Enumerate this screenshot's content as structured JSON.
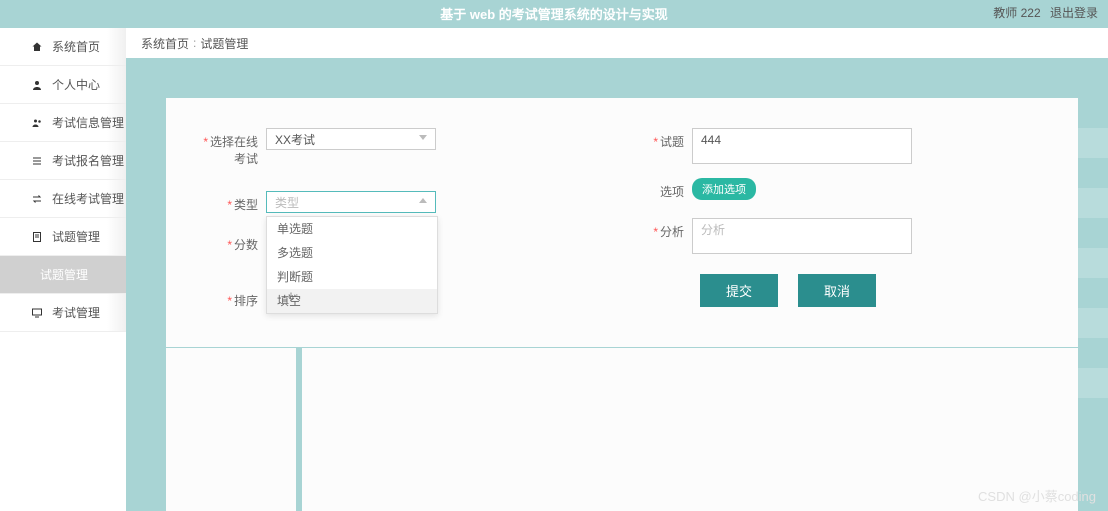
{
  "header": {
    "title": "基于 web 的考试管理系统的设计与实现",
    "user": "教师 222",
    "logout": "退出登录"
  },
  "sidebar": {
    "items": [
      {
        "icon": "home",
        "label": "系统首页"
      },
      {
        "icon": "user",
        "label": "个人中心"
      },
      {
        "icon": "users",
        "label": "考试信息管理"
      },
      {
        "icon": "list",
        "label": "考试报名管理"
      },
      {
        "icon": "exchange",
        "label": "在线考试管理"
      },
      {
        "icon": "doc",
        "label": "试题管理"
      },
      {
        "icon": "",
        "label": "试题管理",
        "sub": true
      },
      {
        "icon": "monitor",
        "label": "考试管理"
      }
    ]
  },
  "breadcrumb": {
    "root": "系统首页",
    "current": "试题管理"
  },
  "form": {
    "left": {
      "exam_label": "选择在线考试",
      "exam_value": "XX考试",
      "type_label": "类型",
      "type_placeholder": "类型",
      "type_options": [
        "单选题",
        "多选题",
        "判断题",
        "填空"
      ],
      "score_label": "分数",
      "order_label": "排序"
    },
    "right": {
      "question_label": "试题",
      "question_value": "444",
      "options_label": "选项",
      "add_option_label": "添加选项",
      "analysis_label": "分析",
      "analysis_placeholder": "分析",
      "submit_label": "提交",
      "cancel_label": "取消"
    }
  },
  "watermark": "CSDN @小蔡coding"
}
